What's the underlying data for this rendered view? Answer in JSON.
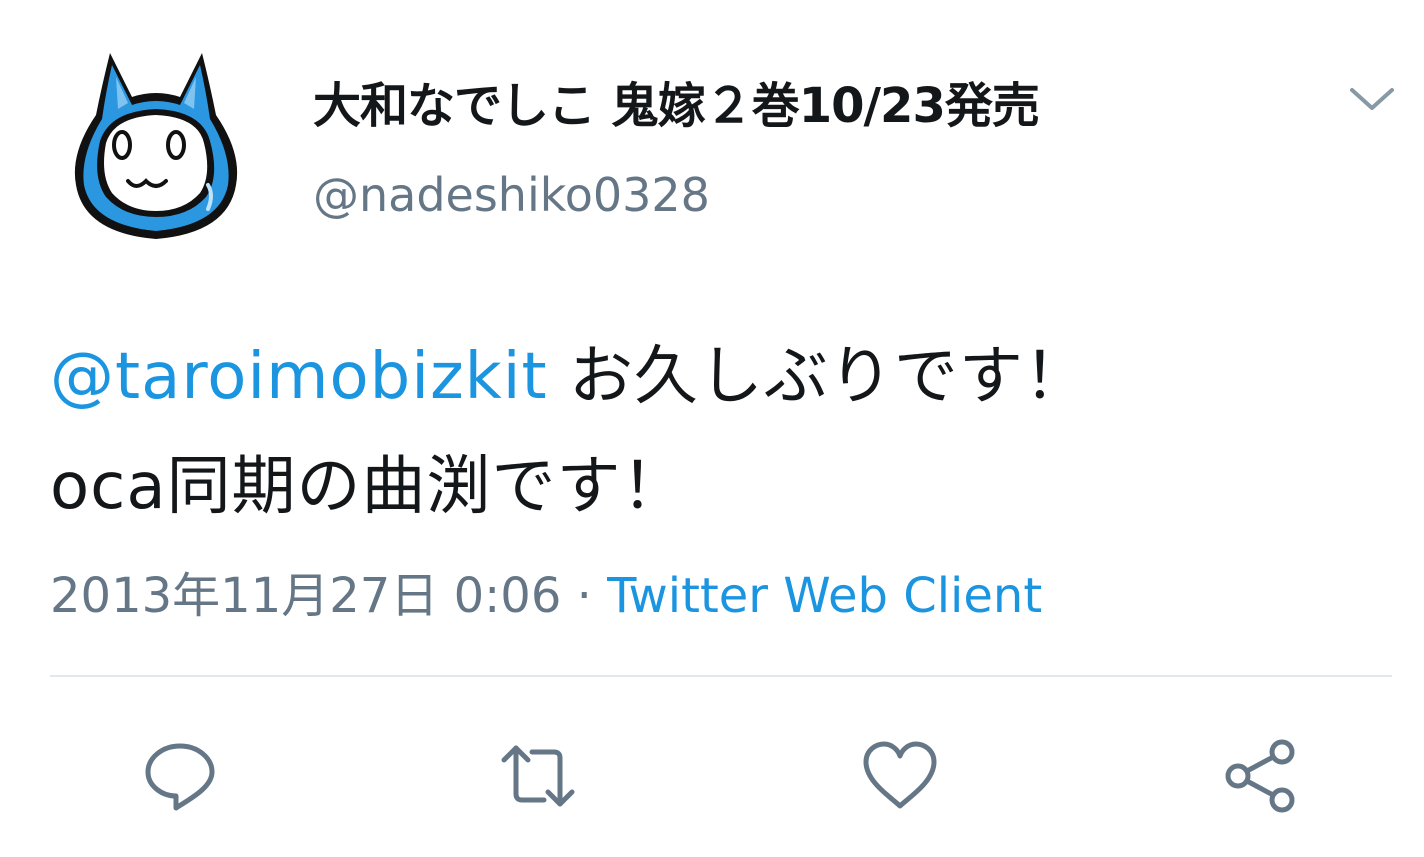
{
  "tweet": {
    "display_name": "大和なでしこ 鬼嫁２巻10/23発売",
    "handle": "@nadeshiko0328",
    "mention": "@taroimobizkit",
    "text_line1_rest": " お久しぶりです！",
    "text_line2": "oca同期の曲渕です！",
    "timestamp": "2013年11月27日 0:06",
    "separator": " · ",
    "source": "Twitter Web Client"
  },
  "colors": {
    "link": "#1b95e0",
    "secondary": "#657786",
    "text": "#14171a",
    "avatar_blue": "#2b97e0"
  },
  "icons": {
    "menu": "chevron-down-icon",
    "reply": "reply-icon",
    "retweet": "retweet-icon",
    "like": "heart-icon",
    "share": "share-icon"
  }
}
